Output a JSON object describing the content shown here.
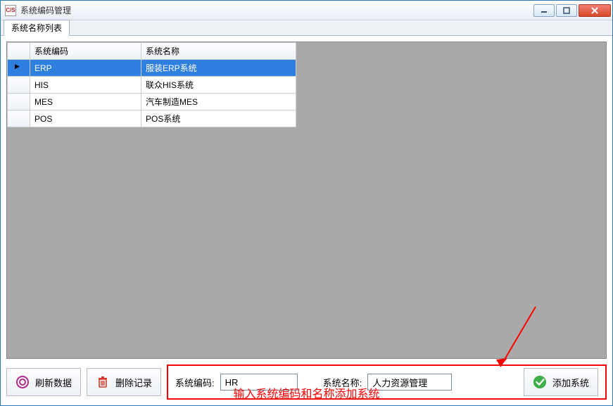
{
  "window": {
    "title": "系统编码管理"
  },
  "tab": {
    "label": "系统名称列表"
  },
  "table": {
    "columns": {
      "code": "系统编码",
      "name": "系统名称"
    },
    "rows": [
      {
        "code": "ERP",
        "name": "服装ERP系统",
        "selected": true
      },
      {
        "code": "HIS",
        "name": "联众HIS系统",
        "selected": false
      },
      {
        "code": "MES",
        "name": "汽车制造MES",
        "selected": false
      },
      {
        "code": "POS",
        "name": "POS系统",
        "selected": false
      }
    ]
  },
  "buttons": {
    "refresh": "刷新数据",
    "delete": "删除记录",
    "add": "添加系统"
  },
  "form": {
    "code_label": "系统编码:",
    "name_label": "系统名称:",
    "code_value": "HR",
    "name_value": "人力资源管理"
  },
  "annotation": "输入系统编码和名称添加系统"
}
